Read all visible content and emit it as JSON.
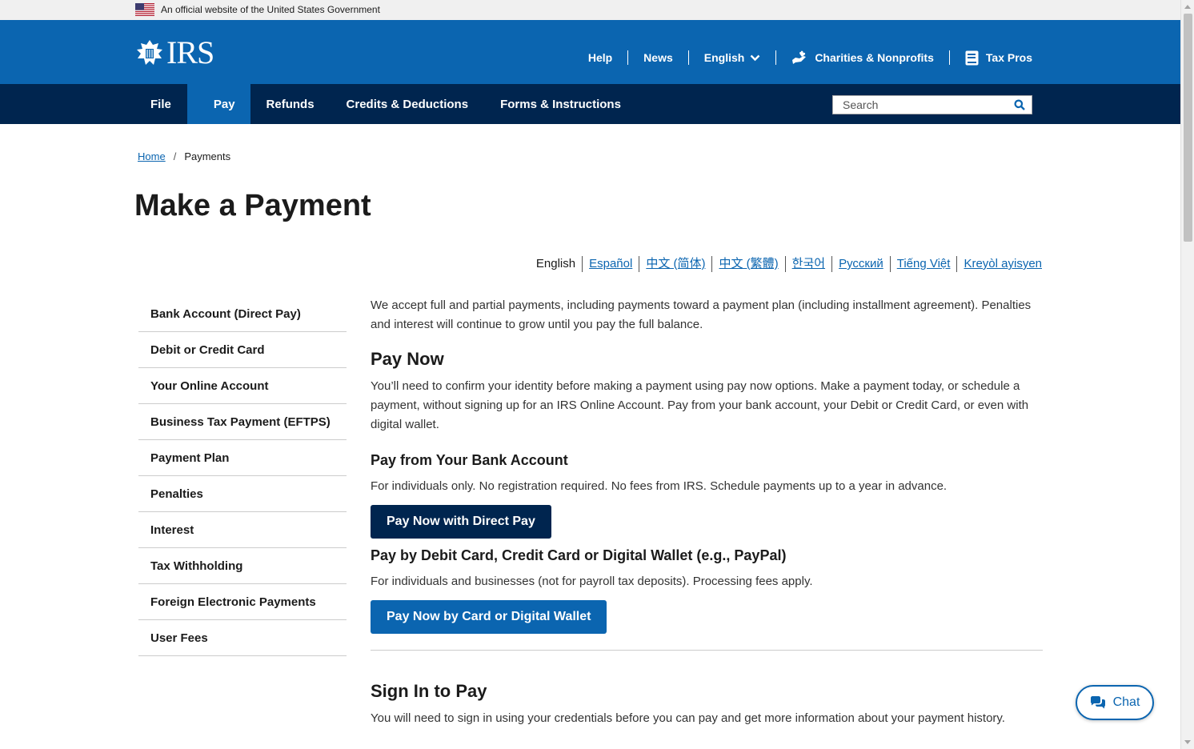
{
  "gov_banner": {
    "text": "An official website of the United States Government"
  },
  "header": {
    "logo_text": "IRS",
    "util_nav": {
      "help": "Help",
      "news": "News",
      "language": "English",
      "charities": "Charities & Nonprofits",
      "tax_pros": "Tax Pros"
    }
  },
  "mainnav": {
    "items": [
      "File",
      "Pay",
      "Refunds",
      "Credits & Deductions",
      "Forms & Instructions"
    ],
    "active": "Pay",
    "search_placeholder": "Search"
  },
  "breadcrumb": {
    "home": "Home",
    "separator": "/",
    "current": "Payments"
  },
  "page_title": "Make a Payment",
  "languages": [
    "English",
    "Español",
    "中文 (简体)",
    "中文 (繁體)",
    "한국어",
    "Русский",
    "Tiếng Việt",
    "Kreyòl ayisyen"
  ],
  "sidebar": {
    "items": [
      "Bank Account (Direct Pay)",
      "Debit or Credit Card",
      "Your Online Account",
      "Business Tax Payment (EFTPS)",
      "Payment Plan",
      "Penalties",
      "Interest",
      "Tax Withholding",
      "Foreign Electronic Payments",
      "User Fees"
    ]
  },
  "content": {
    "intro": "We accept full and partial payments, including payments toward a payment plan (including installment agreement). Penalties and interest will continue to grow until you pay the full balance.",
    "pay_now_heading": "Pay Now",
    "pay_now_text": "You’ll need to confirm your identity before making a payment using pay now options. Make a payment today, or schedule a payment, without signing up for an IRS Online Account. Pay from your bank account, your Debit or Credit Card, or even with digital wallet.",
    "bank_heading": "Pay from Your Bank Account",
    "bank_text": "For individuals only. No registration required. No fees from IRS. Schedule payments up to a year in advance.",
    "bank_button": "Pay Now with Direct Pay",
    "card_heading": "Pay by Debit Card, Credit Card or Digital Wallet (e.g., PayPal)",
    "card_text": "For individuals and businesses (not for payroll tax deposits). Processing fees apply.",
    "card_button": "Pay Now by Card or Digital Wallet",
    "signin_heading": "Sign In to Pay",
    "signin_text": "You will need to sign in using your credentials before you can pay and get more information about your payment history."
  },
  "chat": {
    "label": "Chat"
  },
  "colors": {
    "header_blue": "#0b65b0",
    "nav_navy": "#00254f",
    "link_blue": "#0b65b0"
  }
}
